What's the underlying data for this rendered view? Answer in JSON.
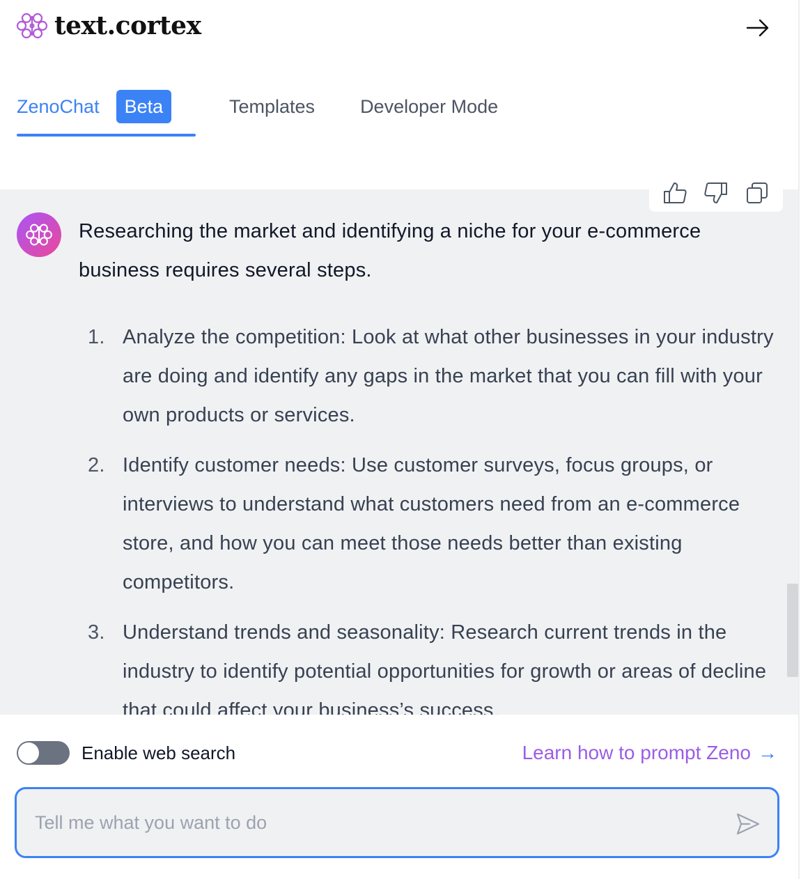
{
  "brand": {
    "name": "text.cortex",
    "logo_icon": "brain-icon",
    "accent_color": "#3b82f6",
    "gradient_colors": [
      "#a855f7",
      "#ec4899"
    ]
  },
  "header": {
    "collapse_icon": "arrow-right-icon"
  },
  "tabs": [
    {
      "label": "ZenoChat",
      "badge": "Beta",
      "active": true
    },
    {
      "label": "Templates",
      "active": false
    },
    {
      "label": "Developer Mode",
      "active": false
    }
  ],
  "message_actions": [
    {
      "icon": "thumbs-up-icon"
    },
    {
      "icon": "thumbs-down-icon"
    },
    {
      "icon": "copy-icon"
    }
  ],
  "chat": {
    "intro": "Researching the market and identifying a niche for your e-commerce business requires several steps.",
    "steps": [
      {
        "num": "1.",
        "text": "Analyze the competition: Look at what other businesses in your industry are doing and identify any gaps in the market that you can fill with your own products or services."
      },
      {
        "num": "2.",
        "text": "Identify customer needs: Use customer surveys, focus groups, or interviews to understand what customers need from an e-commerce store, and how you can meet those needs better than existing competitors."
      },
      {
        "num": "3.",
        "text": "Understand trends and seasonality: Research current trends in the industry to identify potential opportunities for growth or areas of decline that could affect your business’s success."
      }
    ]
  },
  "footer": {
    "web_search_label": "Enable web search",
    "web_search_enabled": false,
    "learn_link": "Learn how to prompt Zeno",
    "learn_arrow": "→",
    "input_placeholder": "Tell me what you want to do",
    "input_value": "",
    "send_icon": "send-icon"
  }
}
